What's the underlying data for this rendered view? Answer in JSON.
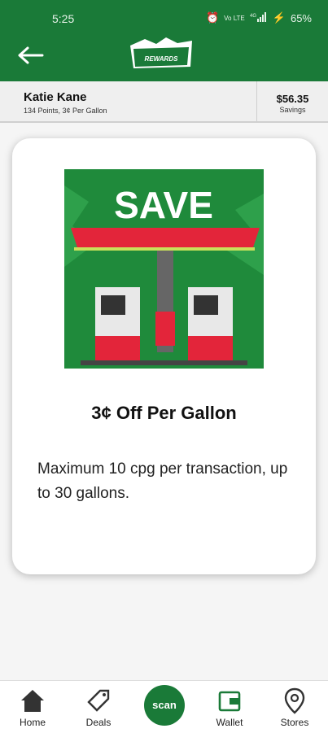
{
  "status_bar": {
    "time": "5:25",
    "battery": "65%",
    "network": "Vo LTE",
    "signal": "4G"
  },
  "header": {
    "logo_text": "REWARDS"
  },
  "user": {
    "name": "Katie Kane",
    "details": "134 Points, 3¢ Per Gallon",
    "savings_amount": "$56.35",
    "savings_label": "Savings"
  },
  "offer": {
    "image_text": "SAVE",
    "title": "3¢ Off Per Gallon",
    "description": "Maximum 10 cpg per transaction, up to 30 gallons."
  },
  "nav": {
    "home": "Home",
    "deals": "Deals",
    "scan": "scan",
    "wallet": "Wallet",
    "stores": "Stores"
  },
  "colors": {
    "brand_green": "#1a7a38",
    "promo_red": "#e3253a"
  }
}
